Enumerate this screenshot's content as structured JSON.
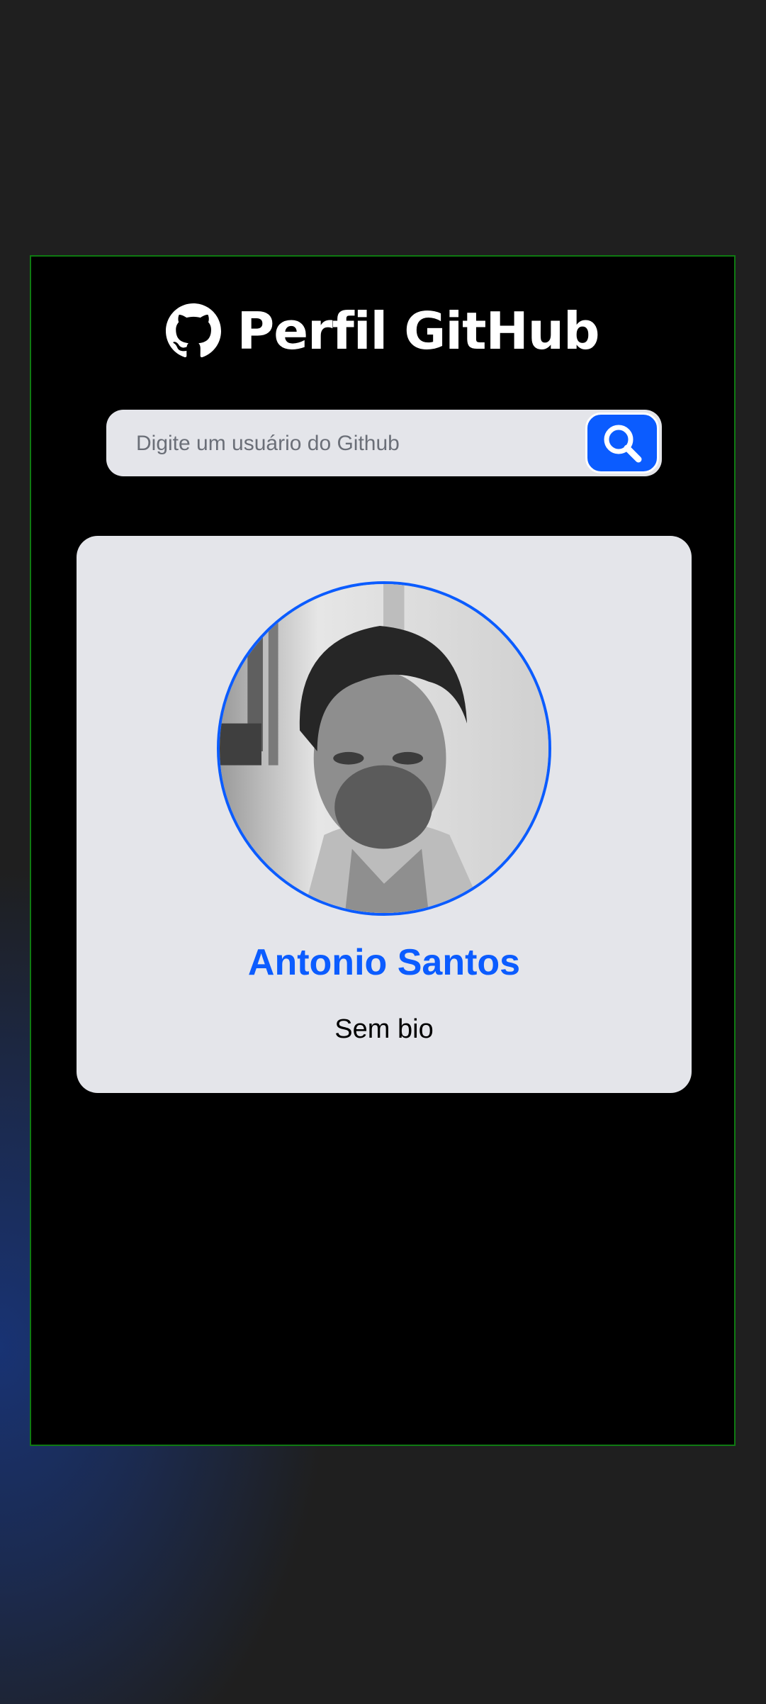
{
  "header": {
    "title": "Perfil GitHub",
    "logo_icon": "github-icon"
  },
  "search": {
    "placeholder": "Digite um usuário do Github",
    "value": "",
    "button_icon": "search-icon"
  },
  "profile": {
    "name": "Antonio Santos",
    "bio": "Sem bio"
  },
  "colors": {
    "accent": "#0b5cff",
    "panel": "#000000",
    "card": "#e4e5ea",
    "background": "#1f1f1f",
    "panel_border": "#0f7a12"
  }
}
